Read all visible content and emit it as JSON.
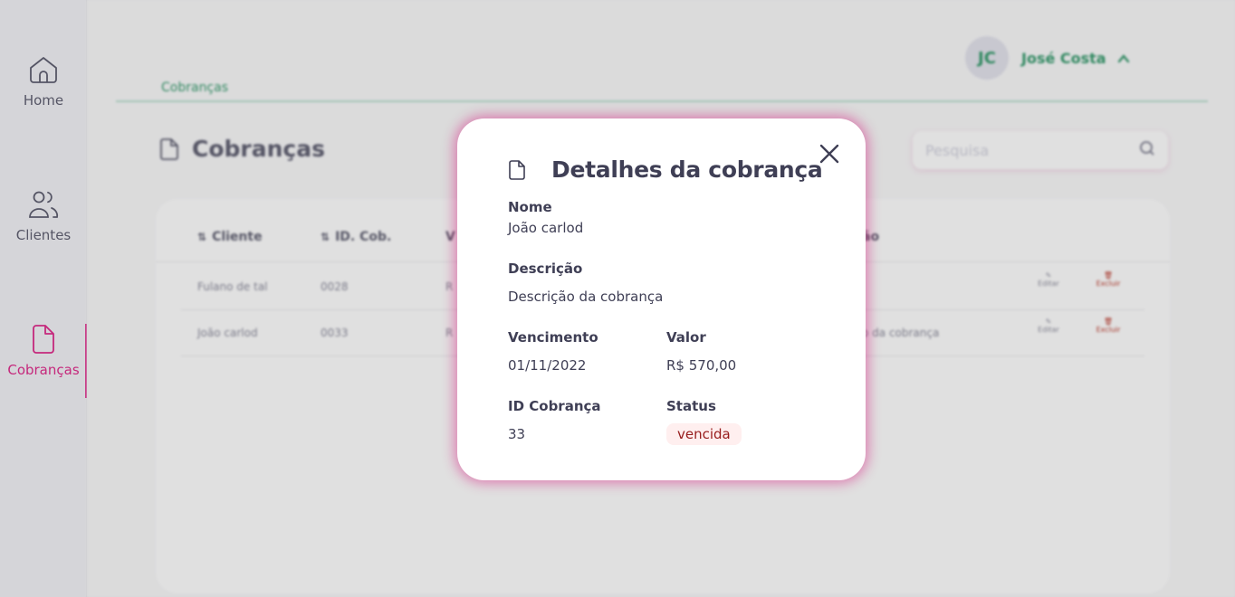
{
  "sidebar": {
    "items": [
      {
        "label": "Home",
        "icon": "home-icon",
        "active": false
      },
      {
        "label": "Clientes",
        "icon": "users-icon",
        "active": false
      },
      {
        "label": "Cobranças",
        "icon": "document-icon",
        "active": true
      }
    ]
  },
  "header": {
    "user": {
      "initials": "JC",
      "name": "José Costa"
    },
    "breadcrumb": "Cobranças"
  },
  "main": {
    "title": "Cobranças",
    "search": {
      "placeholder": "Pesquisa",
      "value": ""
    },
    "table": {
      "columns": [
        "Cliente",
        "ID. Cob.",
        "V",
        "ão"
      ],
      "rows": [
        {
          "cliente": "Fulano de tal",
          "id": "0028",
          "valor": "R",
          "descricao": "",
          "edit_label": "Editar",
          "delete_label": "Excluir"
        },
        {
          "cliente": "João carlod",
          "id": "0033",
          "valor": "R",
          "descricao": "o da cobrança",
          "edit_label": "Editar",
          "delete_label": "Excluir"
        }
      ]
    }
  },
  "modal": {
    "title": "Detalhes da cobrança",
    "fields": {
      "nome": {
        "label": "Nome",
        "value": "João carlod"
      },
      "descricao": {
        "label": "Descrição",
        "value": "Descrição da cobrança"
      },
      "vencimento": {
        "label": "Vencimento",
        "value": "01/11/2022"
      },
      "valor": {
        "label": "Valor",
        "value": "R$ 570,00"
      },
      "id_cobranca": {
        "label": "ID Cobrança",
        "value": "33"
      },
      "status": {
        "label": "Status",
        "value": "vencida"
      }
    }
  },
  "colors": {
    "accent": "#DA0175",
    "green": "#0E8750",
    "text": "#3F3F55",
    "status_overdue_bg": "#FFEFEF",
    "status_overdue_text": "#971D1D"
  }
}
